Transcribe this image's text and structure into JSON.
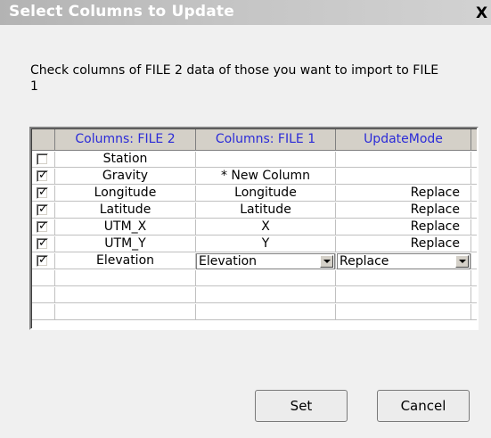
{
  "window": {
    "title": "Select Columns to Update",
    "close_label": "X"
  },
  "instruction": "Check columns of FILE 2 data of those you want to import to FILE 1",
  "table": {
    "headers": {
      "select": "",
      "file2": "Columns: FILE 2",
      "file1": "Columns: FILE 1",
      "update_mode": "UpdateMode"
    },
    "rows": [
      {
        "checked": false,
        "check": "",
        "file2": "Station",
        "file1": "",
        "update_mode": ""
      },
      {
        "checked": true,
        "check": "✓",
        "file2": "Gravity",
        "file1": "* New Column",
        "update_mode": ""
      },
      {
        "checked": true,
        "check": "✓",
        "file2": "Longitude",
        "file1": "Longitude",
        "update_mode": "Replace"
      },
      {
        "checked": true,
        "check": "✓",
        "file2": "Latitude",
        "file1": "Latitude",
        "update_mode": "Replace"
      },
      {
        "checked": true,
        "check": "✓",
        "file2": "UTM_X",
        "file1": "X",
        "update_mode": "Replace"
      },
      {
        "checked": true,
        "check": "✓",
        "file2": "UTM_Y",
        "file1": "Y",
        "update_mode": "Replace"
      },
      {
        "checked": true,
        "check": "✓",
        "file2": "Elevation",
        "file1": "Elevation",
        "update_mode": "Replace",
        "editing": true
      }
    ]
  },
  "buttons": {
    "set": "Set",
    "cancel": "Cancel"
  },
  "colors": {
    "header_text": "#2b2bd8",
    "title_text": "#ffffff",
    "dialog_bg": "#f0f0f0"
  }
}
